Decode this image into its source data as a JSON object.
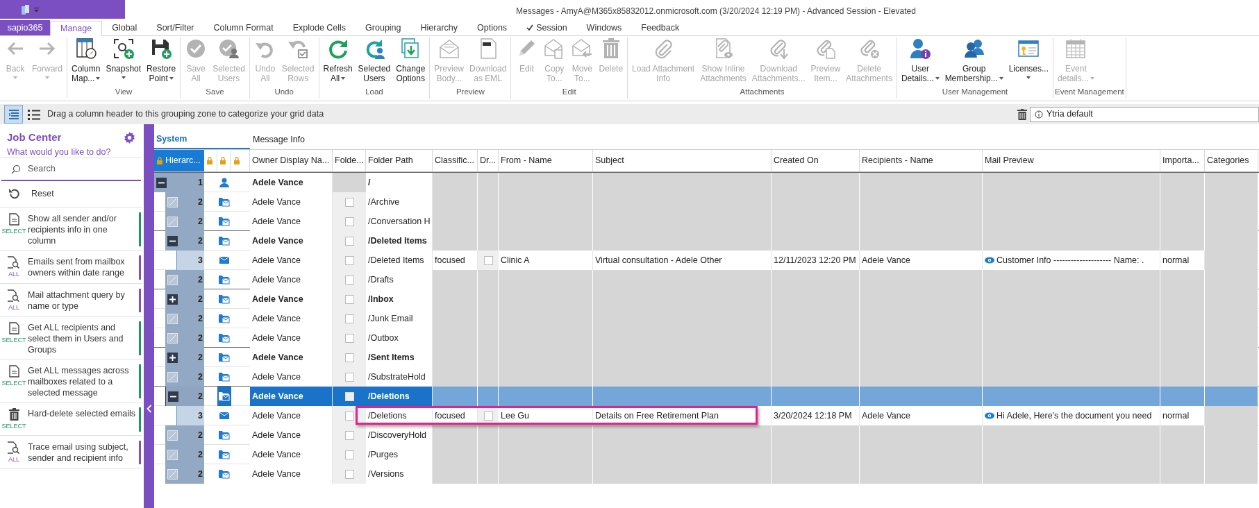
{
  "window": {
    "title": "Messages - AmyA@M365x85832012.onmicrosoft.com (3/20/2024 12:19 PM) - Advanced Session - Elevated"
  },
  "app_tab": "sapio365",
  "tabs": [
    {
      "label": "Manage",
      "selected": true,
      "checked": false
    },
    {
      "label": "Global",
      "selected": false,
      "checked": false
    },
    {
      "label": "Sort/Filter",
      "selected": false,
      "checked": false
    },
    {
      "label": "Column Format",
      "selected": false,
      "checked": false
    },
    {
      "label": "Explode Cells",
      "selected": false,
      "checked": false
    },
    {
      "label": "Grouping",
      "selected": false,
      "checked": false
    },
    {
      "label": "Hierarchy",
      "selected": false,
      "checked": false
    },
    {
      "label": "Options",
      "selected": false,
      "checked": false
    },
    {
      "label": "Session",
      "selected": false,
      "checked": true
    },
    {
      "label": "Windows",
      "selected": false,
      "checked": false
    },
    {
      "label": "Feedback",
      "selected": false,
      "checked": false
    }
  ],
  "ribbon": [
    {
      "buttons": [
        {
          "lines": [
            "Back"
          ],
          "disabled": true,
          "dropdown": true
        },
        {
          "lines": [
            "Forward"
          ],
          "disabled": true,
          "dropdown": true
        }
      ]
    },
    {
      "label": "View",
      "buttons": [
        {
          "lines": [
            "Column",
            "Map..."
          ],
          "disabled": false,
          "dropdown": true
        },
        {
          "lines": [
            "Snapshot"
          ],
          "disabled": false,
          "dropdown": true
        },
        {
          "lines": [
            "Restore",
            "Point"
          ],
          "disabled": false,
          "dropdown": true
        }
      ]
    },
    {
      "label": "Save",
      "buttons": [
        {
          "lines": [
            "Save",
            "All"
          ],
          "disabled": true,
          "dropdown": false
        },
        {
          "lines": [
            "Selected",
            "Users"
          ],
          "disabled": true,
          "dropdown": false
        }
      ]
    },
    {
      "label": "Undo",
      "buttons": [
        {
          "lines": [
            "Undo",
            "All"
          ],
          "disabled": true,
          "dropdown": false
        },
        {
          "lines": [
            "Selected",
            "Rows"
          ],
          "disabled": true,
          "dropdown": false
        }
      ]
    },
    {
      "label": "Load",
      "buttons": [
        {
          "lines": [
            "Refresh",
            "All"
          ],
          "disabled": false,
          "dropdown": true
        },
        {
          "lines": [
            "Selected",
            "Users"
          ],
          "disabled": false,
          "dropdown": false
        },
        {
          "lines": [
            "Change",
            "Options"
          ],
          "disabled": false,
          "dropdown": false
        }
      ]
    },
    {
      "label": "Preview",
      "buttons": [
        {
          "lines": [
            "Preview",
            "Body..."
          ],
          "disabled": true,
          "dropdown": false
        },
        {
          "lines": [
            "Download",
            "as EML"
          ],
          "disabled": true,
          "dropdown": false
        }
      ]
    },
    {
      "label": "Edit",
      "buttons": [
        {
          "lines": [
            "Edit"
          ],
          "disabled": true,
          "dropdown": false
        },
        {
          "lines": [
            "Copy",
            "To..."
          ],
          "disabled": true,
          "dropdown": false
        },
        {
          "lines": [
            "Move",
            "To..."
          ],
          "disabled": true,
          "dropdown": false
        },
        {
          "lines": [
            "Delete"
          ],
          "disabled": true,
          "dropdown": false
        }
      ]
    },
    {
      "label": "Attachments",
      "buttons": [
        {
          "lines": [
            "Load Attachment",
            "Info"
          ],
          "disabled": true,
          "dropdown": false
        },
        {
          "lines": [
            "Show Inline",
            "Attachments"
          ],
          "disabled": true,
          "dropdown": false
        },
        {
          "lines": [
            "Download",
            "Attachments..."
          ],
          "disabled": true,
          "dropdown": false
        },
        {
          "lines": [
            "Preview",
            "Item..."
          ],
          "disabled": true,
          "dropdown": false
        },
        {
          "lines": [
            "Delete",
            "Attachments"
          ],
          "disabled": true,
          "dropdown": false
        }
      ]
    },
    {
      "label": "User Management",
      "buttons": [
        {
          "lines": [
            "User",
            "Details..."
          ],
          "disabled": false,
          "dropdown": true
        },
        {
          "lines": [
            "Group",
            "Membership..."
          ],
          "disabled": false,
          "dropdown": true
        },
        {
          "lines": [
            "Licenses..."
          ],
          "disabled": false,
          "dropdown": true
        }
      ]
    },
    {
      "label": "Event Management",
      "buttons": [
        {
          "lines": [
            "Event",
            "details..."
          ],
          "disabled": true,
          "dropdown": true
        }
      ]
    }
  ],
  "grouping_bar": {
    "views": [
      {
        "selected": true
      },
      {
        "selected": false
      }
    ],
    "hint": "Drag a column header to this grouping zone to categorize your grid data",
    "preset": "Ytria default"
  },
  "job_center": {
    "title": "Job Center",
    "subtitle": "What would you like to do?",
    "search": {
      "placeholder": "Search"
    },
    "reset": "Reset",
    "jobs": [
      {
        "text": "Show all sender and/or recipients info in one column",
        "scope": "SELECT",
        "color": "#1a9a62"
      },
      {
        "text": "Emails sent from mailbox owners within date range",
        "scope": "ALL",
        "color": "#8a4cc4"
      },
      {
        "text": "Mail attachment query by name or type",
        "scope": "ALL",
        "color": "#8a4cc4"
      },
      {
        "text": "Get ALL recipients and select them in Users and Groups",
        "scope": "SELECT",
        "color": "#1a9a62"
      },
      {
        "text": "Get ALL messages across mailboxes related to a selected message",
        "scope": "SELECT",
        "color": "#1a9a62"
      },
      {
        "text": "Hard-delete selected emails",
        "scope": "SELECT",
        "color": "#1a9a62"
      },
      {
        "text": "Trace email using subject, sender and recipient info",
        "scope": "ALL",
        "color": "#8a4cc4"
      }
    ]
  },
  "grid": {
    "bands": [
      "System",
      "Message Info"
    ],
    "columns": [
      {
        "label": "Hierarc...",
        "locked": true
      },
      {
        "locked": true
      },
      {
        "locked": true
      },
      {
        "locked": true
      },
      {
        "label": "Owner Display Na...",
        "locked": false
      },
      {
        "label": "Folde...",
        "locked": false
      },
      {
        "label": "Folder Path",
        "locked": false
      },
      {
        "label": "Classific...",
        "locked": false
      },
      {
        "label": "Dr...",
        "locked": false
      },
      {
        "label": "From - Name",
        "locked": false
      },
      {
        "label": "Subject",
        "locked": false
      },
      {
        "label": "Created On",
        "locked": false
      },
      {
        "label": "Recipients - Name",
        "locked": false
      },
      {
        "label": "Mail Preview",
        "locked": false
      },
      {
        "label": "Importa...",
        "locked": false
      },
      {
        "label": "Categories",
        "locked": false
      }
    ],
    "rows": [
      {
        "kind": "mailbox",
        "hierarchy": "1",
        "owner": "Adele Vance",
        "path": "/",
        "expanded": true,
        "selected": false,
        "children": [
          {
            "kind": "folder",
            "hierarchy": "2",
            "owner": "Adele Vance",
            "path": "/Archive",
            "checked": false,
            "selected": false
          },
          {
            "kind": "folder",
            "hierarchy": "2",
            "owner": "Adele Vance",
            "path": "/Conversation H",
            "checked": false,
            "selected": false
          },
          {
            "kind": "folder",
            "hierarchy": "2",
            "owner": "Adele Vance",
            "path": "/Deleted Items",
            "checked": false,
            "expanded": true,
            "selected": false,
            "children": [
              {
                "kind": "message",
                "hierarchy": "3",
                "owner": "Adele Vance",
                "path": "/Deleted Items",
                "checked": false,
                "classification": "focused",
                "draft_checked": false,
                "from": "Clinic A",
                "subject": "Virtual consultation - Adele Other",
                "created": "12/11/2023 12:20 PM",
                "recipients": "Adele Vance",
                "preview": "Customer Info -------------------- Name: .",
                "importance": "normal",
                "selected": false
              }
            ]
          },
          {
            "kind": "folder",
            "hierarchy": "2",
            "owner": "Adele Vance",
            "path": "/Drafts",
            "checked": false,
            "selected": false
          },
          {
            "kind": "folder",
            "hierarchy": "2",
            "owner": "Adele Vance",
            "path": "/Inbox",
            "checked": false,
            "expanded": false,
            "selected": false
          },
          {
            "kind": "folder",
            "hierarchy": "2",
            "owner": "Adele Vance",
            "path": "/Junk Email",
            "checked": false,
            "selected": false
          },
          {
            "kind": "folder",
            "hierarchy": "2",
            "owner": "Adele Vance",
            "path": "/Outbox",
            "checked": false,
            "selected": false
          },
          {
            "kind": "folder",
            "hierarchy": "2",
            "owner": "Adele Vance",
            "path": "/Sent Items",
            "checked": false,
            "expanded": false,
            "selected": false
          },
          {
            "kind": "folder",
            "hierarchy": "2",
            "owner": "Adele Vance",
            "path": "/SubstrateHold",
            "checked": false,
            "selected": false
          },
          {
            "kind": "folder",
            "hierarchy": "2",
            "owner": "Adele Vance",
            "path": "/Deletions",
            "checked": false,
            "expanded": true,
            "selected": true,
            "children": [
              {
                "kind": "message",
                "hierarchy": "3",
                "owner": "Adele Vance",
                "path": "/Deletions",
                "checked": false,
                "classification": "focused",
                "draft_checked": false,
                "from": "Lee Gu",
                "subject": "Details on Free Retirement Plan",
                "created": "3/20/2024 12:18 PM",
                "recipients": "Adele Vance",
                "preview": "Hi Adele, Here's the document you need",
                "importance": "normal",
                "selected": false
              }
            ]
          },
          {
            "kind": "folder",
            "hierarchy": "2",
            "owner": "Adele Vance",
            "path": "/DiscoveryHold",
            "checked": false,
            "selected": false
          },
          {
            "kind": "folder",
            "hierarchy": "2",
            "owner": "Adele Vance",
            "path": "/Purges",
            "checked": false,
            "selected": false
          },
          {
            "kind": "folder",
            "hierarchy": "2",
            "owner": "Adele Vance",
            "path": "/Versions",
            "checked": false,
            "selected": false
          }
        ]
      }
    ]
  }
}
